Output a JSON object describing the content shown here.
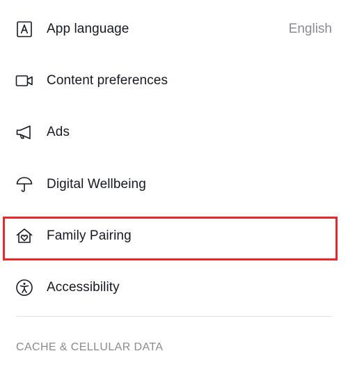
{
  "settings": {
    "items": [
      {
        "label": "App language",
        "value": "English",
        "icon": "app-language-icon"
      },
      {
        "label": "Content preferences",
        "icon": "video-camera-icon"
      },
      {
        "label": "Ads",
        "icon": "megaphone-icon"
      },
      {
        "label": "Digital Wellbeing",
        "icon": "umbrella-icon"
      },
      {
        "label": "Family Pairing",
        "icon": "house-heart-icon",
        "highlighted": true
      },
      {
        "label": "Accessibility",
        "icon": "accessibility-icon"
      }
    ],
    "section_header": "CACHE & CELLULAR DATA"
  },
  "colors": {
    "text": "#161823",
    "secondary_text": "#8a8b91",
    "highlight_border": "#e8282b",
    "divider": "#e3e3e4"
  }
}
